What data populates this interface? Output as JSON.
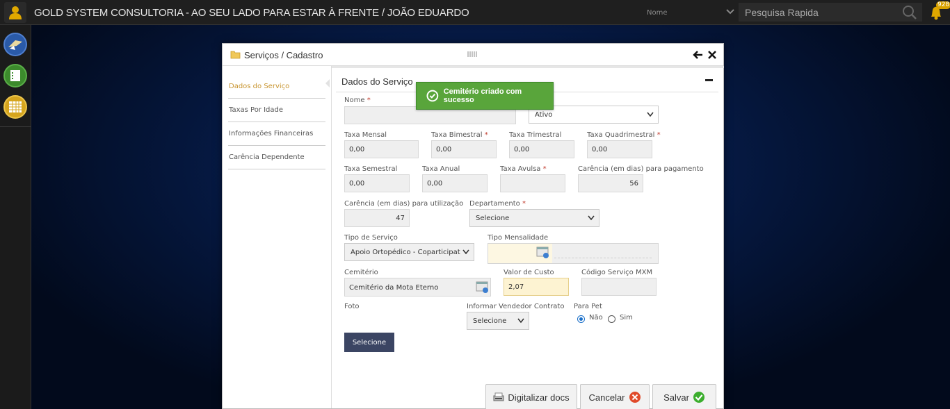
{
  "header": {
    "title": "GOLD SYSTEM CONSULTORIA - AO SEU LADO PARA ESTAR À FRENTE / JOÃO EDUARDO",
    "search_scope": "Nome",
    "search_placeholder": "Pesquisa Rapida",
    "notification_count": "928"
  },
  "sidebar": {
    "items": [
      {
        "icon": "rocket-icon",
        "color": "#2a5aa8"
      },
      {
        "icon": "list-icon",
        "color": "#3c8a2c"
      },
      {
        "icon": "grid-icon",
        "color": "#d6a51e"
      }
    ]
  },
  "modal": {
    "title": "Serviços / Cadastro",
    "drag_handle": "||||||"
  },
  "leftnav": {
    "items": [
      {
        "label": "Dados do Serviço",
        "active": true
      },
      {
        "label": "Taxas Por Idade",
        "active": false
      },
      {
        "label": "Informações Financeiras",
        "active": false
      },
      {
        "label": "Carência Dependente",
        "active": false
      }
    ]
  },
  "form": {
    "section_title": "Dados do Serviço",
    "nome": {
      "label": "Nome",
      "required": "*",
      "value": ""
    },
    "status": {
      "value": "Ativo"
    },
    "taxa_mensal": {
      "label": "Taxa Mensal",
      "value": "0,00"
    },
    "taxa_bimestral": {
      "label": "Taxa Bimestral",
      "required": "*",
      "value": "0,00"
    },
    "taxa_trimestral": {
      "label": "Taxa Trimestral",
      "value": "0,00"
    },
    "taxa_quadrimestral": {
      "label": "Taxa Quadrimestral",
      "required": "*",
      "value": "0,00"
    },
    "taxa_semestral": {
      "label": "Taxa Semestral",
      "value": "0,00"
    },
    "taxa_anual": {
      "label": "Taxa Anual",
      "value": "0,00"
    },
    "taxa_avulsa": {
      "label": "Taxa Avulsa",
      "required": "*",
      "value": ""
    },
    "carencia_pagamento": {
      "label": "Carência (em dias) para pagamento",
      "value": "56"
    },
    "carencia_utilizacao": {
      "label": "Carência (em dias) para utilização",
      "value": "47"
    },
    "departamento": {
      "label": "Departamento",
      "required": "*",
      "value": "Selecione"
    },
    "tipo_servico": {
      "label": "Tipo de Serviço",
      "value": "Apoio Ortopédico - Coparticipati"
    },
    "tipo_mensalidade": {
      "label": "Tipo Mensalidade",
      "value": ""
    },
    "cemiterio": {
      "label": "Cemitério",
      "value": "Cemitério da Mota Eterno"
    },
    "valor_custo": {
      "label": "Valor de Custo",
      "value": "2,07"
    },
    "codigo_mxm": {
      "label": "Código Serviço MXM",
      "value": ""
    },
    "foto": {
      "label": "Foto",
      "button": "Selecione"
    },
    "vendedor": {
      "label": "Informar Vendedor Contrato",
      "value": "Selecione"
    },
    "para_pet": {
      "label": "Para Pet",
      "options": [
        "Não",
        "Sim"
      ],
      "selected": "Não"
    }
  },
  "actions": {
    "digitalizar": "Digitalizar docs",
    "cancelar": "Cancelar",
    "salvar": "Salvar"
  },
  "toast": {
    "message": "Cemitério criado com sucesso",
    "color": "#59a53b"
  }
}
